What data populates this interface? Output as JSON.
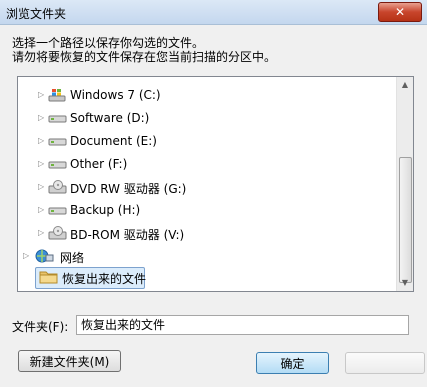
{
  "window": {
    "title": "浏览文件夹",
    "close_label": "✕"
  },
  "instructions": {
    "line1": "选择一个路径以保存你勾选的文件。",
    "line2": "请勿将要恢复的文件保存在您当前扫描的分区中。"
  },
  "tree": {
    "items": [
      {
        "label": "Windows 7 (C:)",
        "icon": "windows-drive-icon"
      },
      {
        "label": "Software (D:)",
        "icon": "drive-icon"
      },
      {
        "label": "Document (E:)",
        "icon": "drive-icon"
      },
      {
        "label": "Other (F:)",
        "icon": "drive-icon"
      },
      {
        "label": "DVD RW 驱动器 (G:)",
        "icon": "dvd-drive-icon"
      },
      {
        "label": "Backup (H:)",
        "icon": "drive-icon"
      },
      {
        "label": "BD-ROM 驱动器 (V:)",
        "icon": "dvd-drive-icon"
      },
      {
        "label": "网络",
        "icon": "network-icon"
      },
      {
        "label": "恢复出来的文件",
        "icon": "folder-icon",
        "selected": true
      }
    ]
  },
  "folder_field": {
    "label": "文件夹(F):",
    "value": "恢复出来的文件"
  },
  "buttons": {
    "new_folder": "新建文件夹(M)",
    "ok": "确定",
    "cancel": ""
  }
}
